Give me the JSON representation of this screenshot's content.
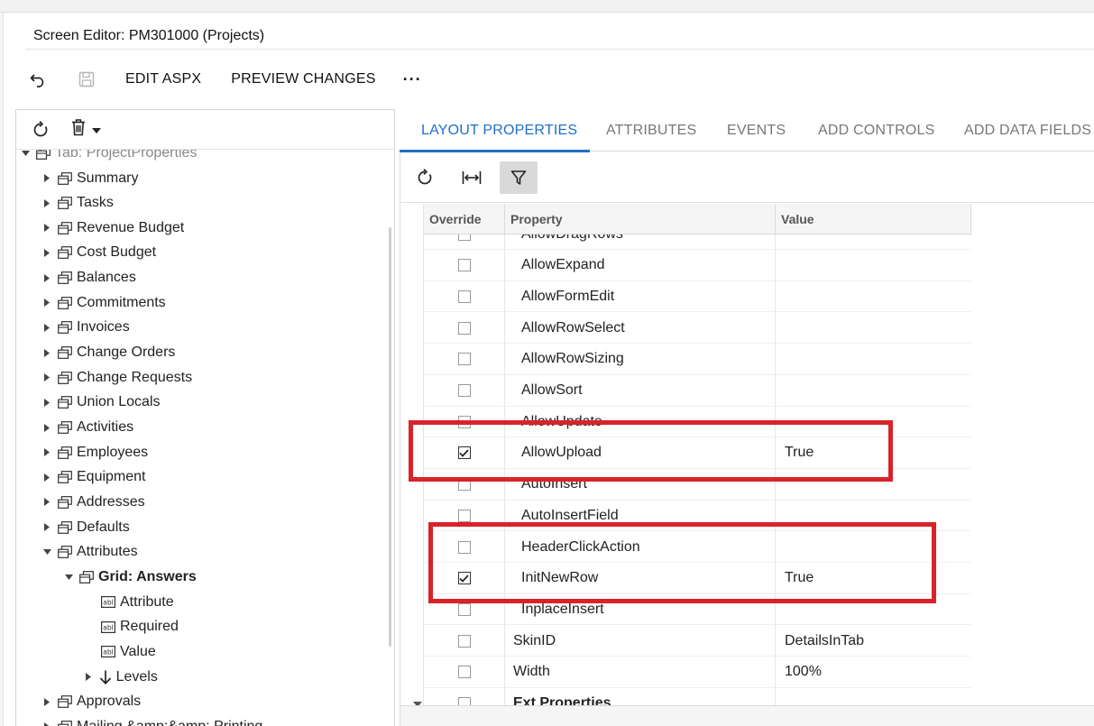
{
  "window": {
    "title": "Screen Editor: PM301000 (Projects)"
  },
  "toolbar": {
    "undo_icon": "undo-icon",
    "save_icon": "save-icon",
    "edit_aspx": "EDIT ASPX",
    "preview_changes": "PREVIEW CHANGES",
    "more": "···"
  },
  "tree": {
    "items": [
      {
        "label": "Tab: ProjectProperties"
      },
      {
        "label": "Summary"
      },
      {
        "label": "Tasks"
      },
      {
        "label": "Revenue Budget"
      },
      {
        "label": "Cost Budget"
      },
      {
        "label": "Balances"
      },
      {
        "label": "Commitments"
      },
      {
        "label": "Invoices"
      },
      {
        "label": "Change Orders"
      },
      {
        "label": "Change Requests"
      },
      {
        "label": "Union Locals"
      },
      {
        "label": "Activities"
      },
      {
        "label": "Employees"
      },
      {
        "label": "Equipment"
      },
      {
        "label": "Addresses"
      },
      {
        "label": "Defaults"
      },
      {
        "label": "Attributes"
      },
      {
        "label": "Grid: Answers"
      },
      {
        "label": "Attribute"
      },
      {
        "label": "Required"
      },
      {
        "label": "Value"
      },
      {
        "label": "Levels"
      },
      {
        "label": "Approvals"
      },
      {
        "label": "Mailing &amp;&amp; Printing"
      }
    ]
  },
  "tabs": [
    {
      "label": "LAYOUT PROPERTIES",
      "active": true
    },
    {
      "label": "ATTRIBUTES"
    },
    {
      "label": "EVENTS"
    },
    {
      "label": "ADD CONTROLS"
    },
    {
      "label": "ADD DATA FIELDS"
    }
  ],
  "grid": {
    "columns": {
      "override": "Override",
      "property": "Property",
      "value": "Value"
    },
    "rows": [
      {
        "property": "AllowDragRows",
        "value": "",
        "checked": false
      },
      {
        "property": "AllowExpand",
        "value": "",
        "checked": false
      },
      {
        "property": "AllowFormEdit",
        "value": "",
        "checked": false
      },
      {
        "property": "AllowRowSelect",
        "value": "",
        "checked": false
      },
      {
        "property": "AllowRowSizing",
        "value": "",
        "checked": false
      },
      {
        "property": "AllowSort",
        "value": "",
        "checked": false
      },
      {
        "property": "AllowUpdate",
        "value": "",
        "checked": false
      },
      {
        "property": "AllowUpload",
        "value": "True",
        "checked": true
      },
      {
        "property": "AutoInsert",
        "value": "",
        "checked": false
      },
      {
        "property": "AutoInsertField",
        "value": "",
        "checked": false
      },
      {
        "property": "HeaderClickAction",
        "value": "",
        "checked": false
      },
      {
        "property": "InitNewRow",
        "value": "True",
        "checked": true
      },
      {
        "property": "InplaceInsert",
        "value": "",
        "checked": false
      },
      {
        "property": "SkinID",
        "value": "DetailsInTab",
        "checked": false
      },
      {
        "property": "Width",
        "value": "100%",
        "checked": false
      },
      {
        "property": "Ext Properties",
        "value": "",
        "checked": false
      }
    ]
  },
  "colors": {
    "accent": "#1e6fc8",
    "highlight": "#d9232a"
  }
}
